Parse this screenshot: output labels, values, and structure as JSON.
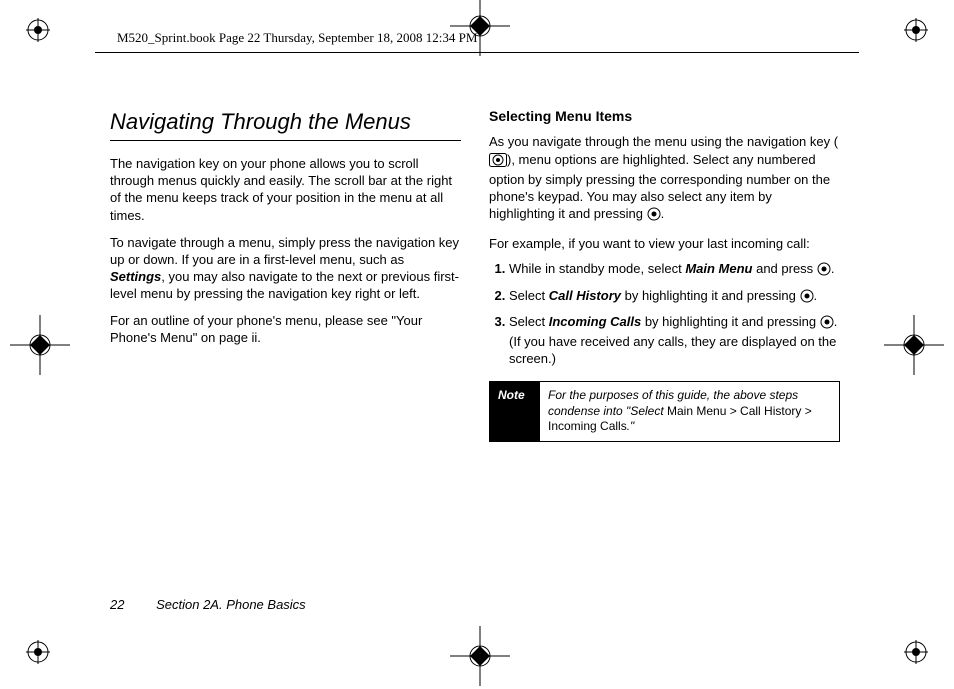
{
  "header_text": "M520_Sprint.book  Page 22  Thursday, September 18, 2008  12:34 PM",
  "left": {
    "title": "Navigating Through the Menus",
    "p1": "The navigation key on your phone allows you to scroll through menus quickly and easily. The scroll bar at the right of the menu keeps track of your position in the menu at all times.",
    "p2a": "To navigate through a menu, simply press the navigation key up or down. If you are in a first-level menu, such as ",
    "p2_bold": "Settings",
    "p2b": ", you may also navigate to the next or previous first-level menu by pressing the navigation key right or left.",
    "p3": "For an outline of your phone's menu, please see \"Your Phone's Menu\" on page ii."
  },
  "right": {
    "subhead": "Selecting Menu Items",
    "p1a": "As you navigate through the menu using the navigation key (",
    "p1b": "), menu options are highlighted. Select any numbered option by simply pressing the corresponding number on the phone's keypad. You may also select any item by highlighting it and pressing ",
    "p1c": ".",
    "p2": "For example, if you want to view your last incoming call:",
    "step1a": "While in standby mode, select ",
    "step1_bold": "Main Menu",
    "step1b": " and press ",
    "step1c": ".",
    "step2a": "Select ",
    "step2_bold": "Call History",
    "step2b": " by highlighting it and pressing ",
    "step2c": ".",
    "step3a": "Select ",
    "step3_bold": "Incoming Calls",
    "step3b": " by highlighting it and pressing ",
    "step3c": ". (If you have received any calls, they are displayed on the screen.)"
  },
  "note": {
    "label": "Note",
    "a": "For the purposes of this guide, the above steps condense into \"Select ",
    "plain": "Main Menu > Call History > Incoming Calls",
    "b": ".\""
  },
  "footer": {
    "page": "22",
    "section": "Section 2A. Phone Basics"
  }
}
